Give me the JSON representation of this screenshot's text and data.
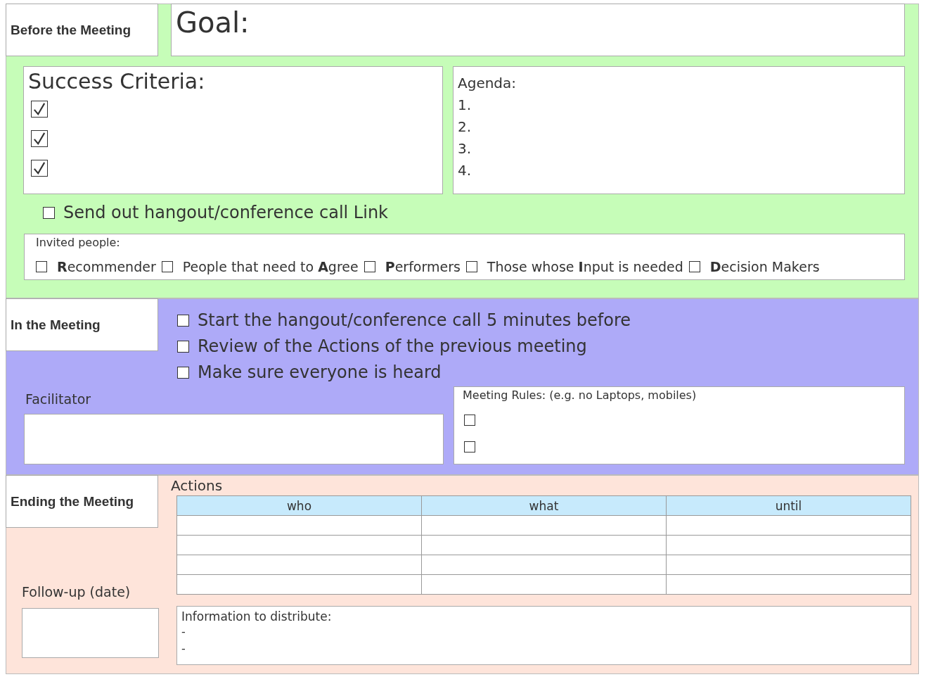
{
  "before": {
    "title": "Before the Meeting",
    "goal": "Goal:",
    "success": {
      "title": "Success  Criteria:",
      "items": [
        {
          "checked": true
        },
        {
          "checked": true
        },
        {
          "checked": true
        }
      ]
    },
    "agenda": {
      "title": "Agenda:",
      "items": [
        "1.",
        "2.",
        "3.",
        "4."
      ]
    },
    "send_link": {
      "label": "Send out hangout/conference call Link",
      "checked": false
    },
    "invited": {
      "title": "Invited  people:",
      "items": [
        {
          "label": "**R**ecommender",
          "checked": false
        },
        {
          "label": "People that need to **A**gree",
          "checked": false
        },
        {
          "label": "**P**erformers",
          "checked": false
        },
        {
          "label": "Those whose **I**nput is needed",
          "checked": false
        },
        {
          "label": "**D**ecision Makers",
          "checked": false
        }
      ]
    }
  },
  "during": {
    "title": "In the Meeting",
    "checklist": [
      {
        "label": "Start the hangout/conference call 5 minutes before",
        "checked": false
      },
      {
        "label": "Review of the Actions of the previous meeting",
        "checked": false
      },
      {
        "label": "Make sure everyone is heard",
        "checked": false
      }
    ],
    "facilitator": "Facilitator",
    "rules": {
      "title": "Meeting  Rules:  (e.g.  no  Laptops,  mobiles)",
      "items": [
        {
          "checked": false
        },
        {
          "checked": false
        }
      ]
    }
  },
  "ending": {
    "title": "Ending the Meeting",
    "actions": {
      "title": "Actions",
      "columns": [
        "who",
        "what",
        "until"
      ],
      "rows": [
        {},
        {},
        {},
        {}
      ]
    },
    "followup": "Follow-up (date)",
    "info": {
      "title": "Information  to  distribute:",
      "items": [
        "-",
        "-"
      ]
    }
  }
}
